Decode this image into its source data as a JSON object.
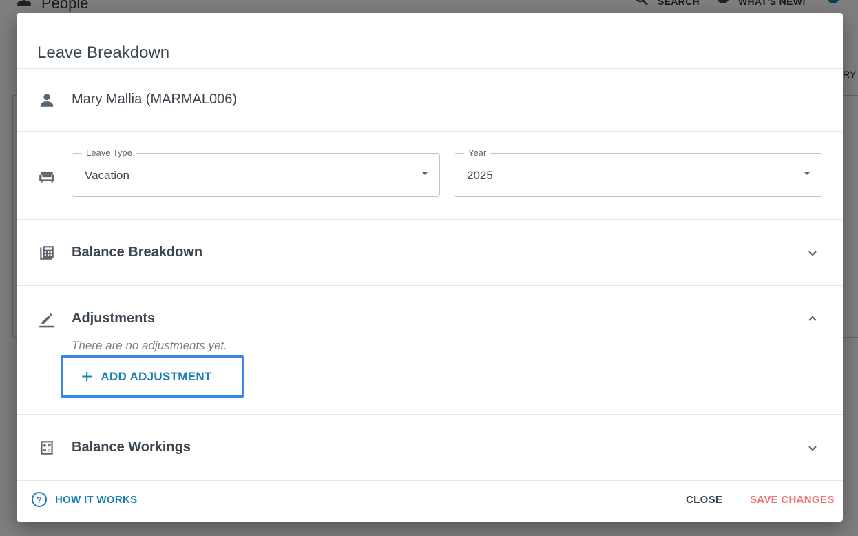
{
  "background": {
    "title": "People",
    "search_label": "SEARCH",
    "whats_new_label": "WHAT'S NEW!",
    "partial_tab_label": "RY"
  },
  "dialog": {
    "title": "Leave Breakdown",
    "employee": "Mary Mallia (MARMAL006)",
    "leave_type": {
      "label": "Leave Type",
      "value": "Vacation"
    },
    "year": {
      "label": "Year",
      "value": "2025"
    },
    "sections": {
      "balance_breakdown": "Balance Breakdown",
      "adjustments": "Adjustments",
      "no_adjustments": "There are no adjustments yet.",
      "add_adjustment": "ADD ADJUSTMENT",
      "balance_workings": "Balance Workings"
    },
    "footer": {
      "how_it_works": "HOW IT WORKS",
      "help_glyph": "?",
      "close": "CLOSE",
      "save": "SAVE CHANGES"
    }
  },
  "colors": {
    "accent": "#1b7fb3",
    "save": "#f06f6f",
    "focus_outline": "#3a86e8",
    "text": "#3b4650"
  },
  "icons": [
    "person-icon",
    "sofa-icon",
    "calculator-grid-icon",
    "pencil-underline-icon",
    "calculator-icon",
    "chevron-down-icon",
    "chevron-up-icon",
    "help-circle-icon",
    "plus-icon",
    "search-icon",
    "gear-icon"
  ]
}
